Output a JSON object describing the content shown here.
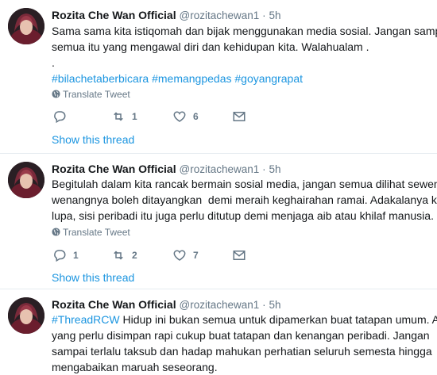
{
  "tweets": [
    {
      "author": "Rozita Che Wan Official",
      "handle": "@rozitachewan1",
      "separator": "·",
      "time": "5h",
      "lines": [
        "Sama sama kita istiqomah dan bijak menggunakan media sosial. Jangan sampai",
        "semua itu yang mengawal diri dan kehidupan kita. Walahualam .",
        "."
      ],
      "hashtags": "#bilachetaberbicara #memangpedas #goyangrapat",
      "translate": "Translate Tweet",
      "reply_count": "",
      "retweet_count": "1",
      "like_count": "6",
      "show_thread": "Show this thread"
    },
    {
      "author": "Rozita Che Wan Official",
      "handle": "@rozitachewan1",
      "separator": "·",
      "time": "5h",
      "lines": [
        "Begitulah dalam kita rancak bermain sosial media, jangan semua dilihat sewenang",
        "wenangnya boleh ditayangkan  demi meraih keghairahan ramai. Adakalanya kita",
        "lupa, sisi peribadi itu juga perlu ditutup demi menjaga aib atau khilaf manusia."
      ],
      "translate": "Translate Tweet",
      "reply_count": "1",
      "retweet_count": "2",
      "like_count": "7",
      "show_thread": "Show this thread"
    },
    {
      "author": "Rozita Che Wan Official",
      "handle": "@rozitachewan1",
      "separator": "·",
      "time": "5h",
      "hashtag_lead": "#ThreadRCW",
      "lines": [
        " Hidup ini bukan semua untuk dipamerkan buat tatapan umum. Ada",
        "yang perlu disimpan rapi cukup buat tatapan dan kenangan peribadi. Jangan",
        "sampai terlalu taksub dan hadap mahukan perhatian seluruh semesta hingga",
        "mengabaikan maruah seseorang."
      ]
    }
  ],
  "icons": {
    "reply": "reply-icon",
    "retweet": "retweet-icon",
    "like": "heart-icon",
    "dm": "envelope-icon",
    "globe": "globe-icon"
  },
  "colors": {
    "link": "#1b95e0",
    "muted": "#657786",
    "text": "#14171a",
    "divider": "#e6ecf0"
  }
}
